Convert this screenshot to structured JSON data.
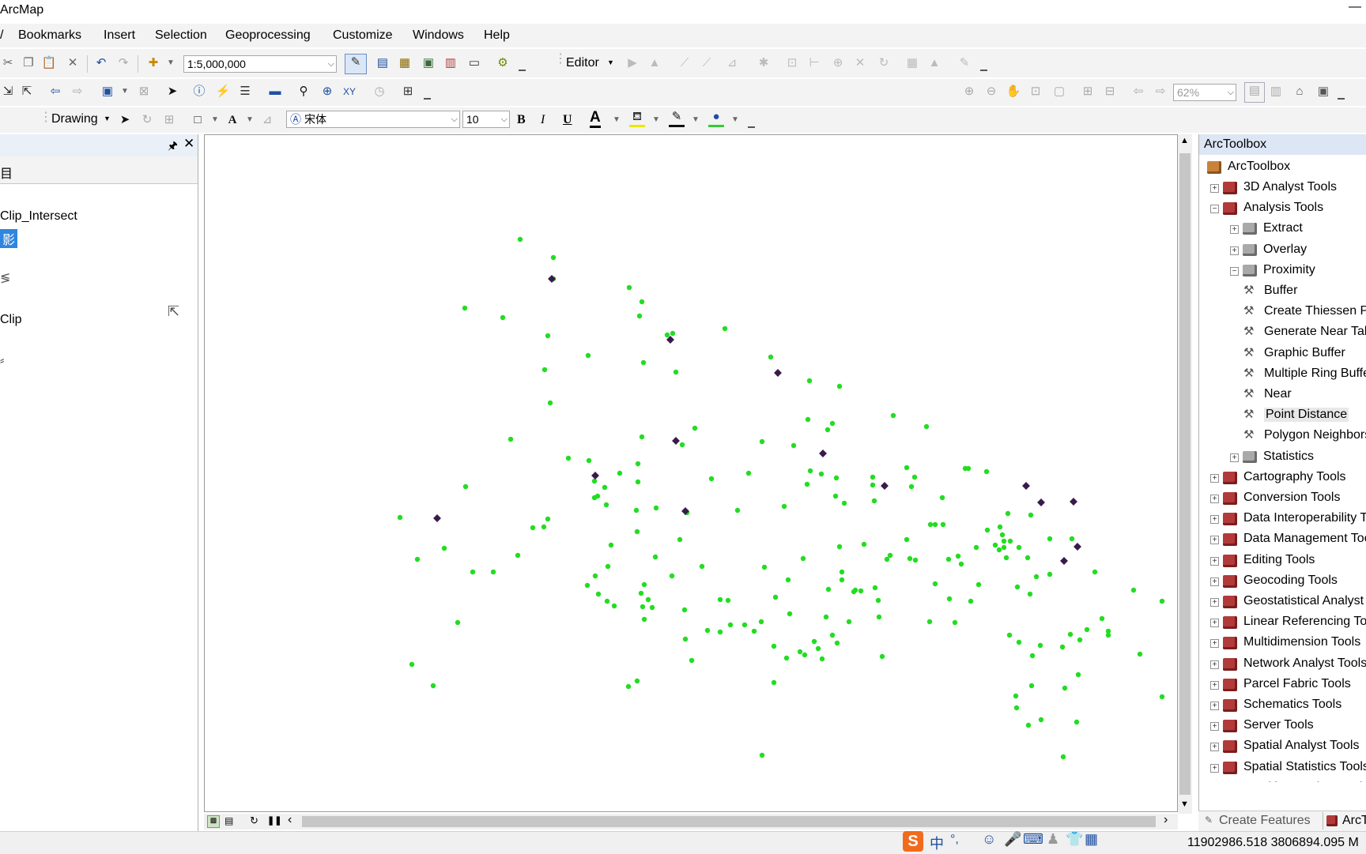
{
  "app": {
    "title": "ArcMap"
  },
  "menu": [
    "Bookmarks",
    "Insert",
    "Selection",
    "Geoprocessing",
    "Customize",
    "Windows",
    "Help"
  ],
  "toolbar": {
    "scale": "1:5,000,000",
    "editor_label": "Editor",
    "zoom_percent": "62%",
    "drawing_label": "Drawing",
    "font_name": "宋体",
    "font_size": "10",
    "bold": "B",
    "italic": "I",
    "underline": "U",
    "font_color_letter": "A"
  },
  "toc": {
    "tab_char": "目",
    "layers": [
      {
        "label": "Clip_Intersect"
      },
      {
        "label": "影",
        "selected": true
      },
      {
        "label": "Clip"
      }
    ]
  },
  "arctoolbox": {
    "title": "ArcToolbox",
    "root": "ArcToolbox",
    "items": [
      {
        "label": "3D Analyst Tools",
        "expander": "+"
      },
      {
        "label": "Analysis Tools",
        "expander": "−"
      },
      {
        "label": "Extract",
        "expander": "+"
      },
      {
        "label": "Overlay",
        "expander": "+"
      },
      {
        "label": "Proximity",
        "expander": "−"
      },
      {
        "label": "Buffer"
      },
      {
        "label": "Create Thiessen Polygons"
      },
      {
        "label": "Generate Near Table"
      },
      {
        "label": "Graphic Buffer"
      },
      {
        "label": "Multiple Ring Buffer"
      },
      {
        "label": "Near"
      },
      {
        "label": "Point Distance",
        "highlighted": true
      },
      {
        "label": "Polygon Neighbors"
      },
      {
        "label": "Statistics",
        "expander": "+"
      },
      {
        "label": "Cartography Tools",
        "expander": "+"
      },
      {
        "label": "Conversion Tools",
        "expander": "+"
      },
      {
        "label": "Data Interoperability Tools",
        "expander": "+"
      },
      {
        "label": "Data Management Tools",
        "expander": "+"
      },
      {
        "label": "Editing Tools",
        "expander": "+"
      },
      {
        "label": "Geocoding Tools",
        "expander": "+"
      },
      {
        "label": "Geostatistical Analyst Tools",
        "expander": "+"
      },
      {
        "label": "Linear Referencing Tools",
        "expander": "+"
      },
      {
        "label": "Multidimension Tools",
        "expander": "+"
      },
      {
        "label": "Network Analyst Tools",
        "expander": "+"
      },
      {
        "label": "Parcel Fabric Tools",
        "expander": "+"
      },
      {
        "label": "Schematics Tools",
        "expander": "+"
      },
      {
        "label": "Server Tools",
        "expander": "+"
      },
      {
        "label": "Spatial Analyst Tools",
        "expander": "+"
      },
      {
        "label": "Spatial Statistics Tools",
        "expander": "+"
      },
      {
        "label": "Tracking Analyst Tools",
        "expander": "+"
      }
    ],
    "bottom_tabs": [
      "Create Features",
      "ArcToolbox"
    ]
  },
  "status": {
    "coordinates": "11902986.518  3806894.095 M"
  },
  "ime": {
    "lang": "中"
  },
  "colors": {
    "point_green": "#22dd22",
    "point_dark": "#3a1a4a",
    "header_blue": "#dce6f4",
    "toolbox_red": "#b23a3a"
  }
}
